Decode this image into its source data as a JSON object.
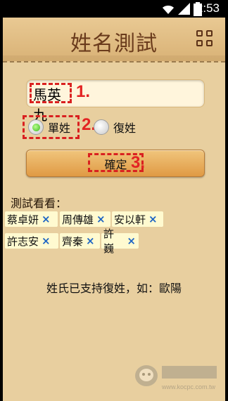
{
  "status_bar": {
    "time": "2:53"
  },
  "header": {
    "title": "姓名測試"
  },
  "form": {
    "name_value": "馬英九",
    "radio_single_label": "單姓",
    "radio_double_label": "復姓",
    "selected": "單姓",
    "confirm_label": "確定"
  },
  "annotations": {
    "step1": "1.",
    "step2": "2.",
    "step3": "3."
  },
  "examples": {
    "title": "測試看看：",
    "items": [
      "蔡卓妍",
      "周傳雄",
      "安以軒",
      "許志安",
      "齊秦",
      "許巍"
    ],
    "remove_icon": "×"
  },
  "note": "姓氏已支持復姓，如：歐陽",
  "watermark": {
    "text": "www.kocpc.com.tw"
  },
  "colors": {
    "accent_red": "#e32323",
    "background": "#e8cf9f",
    "button": "#e09a44",
    "chip": "#fffad0"
  }
}
